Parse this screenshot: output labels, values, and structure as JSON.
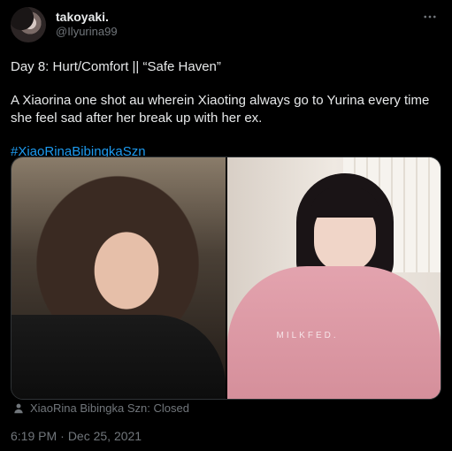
{
  "author": {
    "display_name": "takoyaki.",
    "handle": "@Ilyurina99",
    "avatar_icon": "user-avatar"
  },
  "more_icon": "more-horizontal-icon",
  "tweet": {
    "line1": "Day 8: Hurt/Comfort || “Safe Haven”",
    "line2": "A Xiaorina one shot au wherein Xiaoting always go to Yurina every time she feel sad after her break up with her ex.",
    "hashtag": "#XiaoRinaBibingkaSzn"
  },
  "media": {
    "photo_right_shirt_text": "MILKFED."
  },
  "tagged": {
    "icon": "person-icon",
    "text": "XiaoRina Bibingka Szn: Closed"
  },
  "meta": {
    "time": "6:19 PM",
    "separator": "·",
    "date": "Dec 25, 2021"
  },
  "colors": {
    "background": "#000000",
    "text_primary": "#e7e9ea",
    "text_secondary": "#71767b",
    "link": "#1d9bf0"
  }
}
